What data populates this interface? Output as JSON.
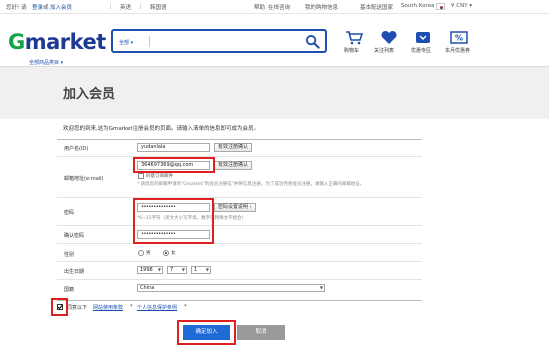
{
  "topbar": {
    "greeting": "您好! 请",
    "login": "登录",
    "or": "或",
    "join": "加入会员",
    "lang_en": "英语",
    "lang_ko": "韩国语",
    "help": "帮助",
    "online_consult": "在线咨询",
    "my_gmarket": "我的购物信息",
    "basic_info": "基本配送国家",
    "country": "South Korea",
    "currency": "¥ CNY ▾"
  },
  "header": {
    "logo_g": "G",
    "logo_rest": "market",
    "search_category": "全部 ▾",
    "cart_label": "购物车",
    "watchlist_label": "关注列表",
    "coupon_label": "优惠专区",
    "discount_label": "本月优惠券",
    "category_menu": "全部商品类目 ▾"
  },
  "page": {
    "title": "加入会员",
    "intro": "欢迎您的到来,这为Gmarket注册会员的页面。请输入清单的信息即可成为会员。"
  },
  "form": {
    "user_id": {
      "label": "用户名(ID)",
      "value": "yudanlala",
      "check_btn": "有效注册确认"
    },
    "email": {
      "label": "邮箱地址(e-mail)",
      "value": "364697369@qq.com",
      "check_btn": "有效注册确认",
      "receive_label": "同意订阅邮件",
      "note1": "* 请您您的邮箱申请的\"Gmarket\"的会员注册信\"并将信息注册，为了成功完善会员注册，请输入正确的邮箱地址。",
      "note2": ""
    },
    "password": {
      "label": "密码",
      "value": "••••••••••••••",
      "rule_btn": "密码设置说明 ›",
      "note": "*6~15字符（英文大小写字母，数字或特殊文字组合）"
    },
    "confirm_password": {
      "label": "确认密码",
      "value": "••••••••••••••"
    },
    "gender": {
      "label": "性别",
      "male": "男",
      "female": "女"
    },
    "birth": {
      "label": "出生日期",
      "year": "1998",
      "month": "7",
      "day": "1"
    },
    "country": {
      "label": "国籍",
      "value": "China"
    }
  },
  "agree": {
    "prefix": "同意以下",
    "terms": "网站使用条款",
    "sep": "*",
    "privacy": "个人信息保护条例",
    "suffix": "*"
  },
  "buttons": {
    "submit": "确定加入",
    "cancel": "取消"
  },
  "colors": {
    "brand_blue": "#1e4fb0",
    "brand_green": "#16a34a",
    "highlight_red": "#e02020",
    "submit_blue": "#1e6ad6"
  }
}
